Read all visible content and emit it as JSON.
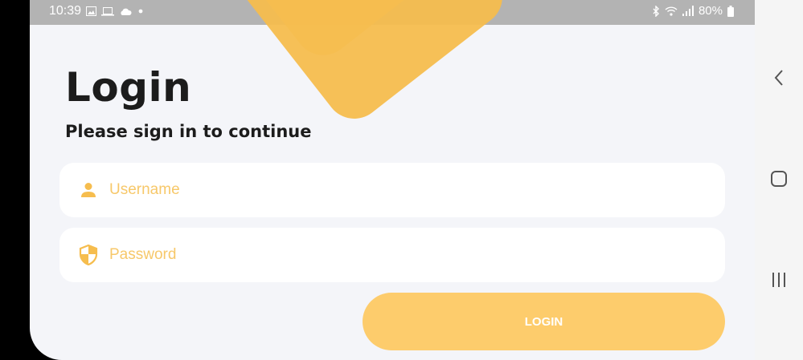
{
  "status_bar": {
    "time": "10:39",
    "battery": "80%",
    "icons": [
      "image-icon",
      "laptop-icon",
      "cloud-icon",
      "dot-icon",
      "bluetooth-icon",
      "wifi-icon",
      "signal-icon",
      "battery-icon"
    ]
  },
  "login": {
    "title": "Login",
    "subtitle": "Please sign in to continue",
    "username_placeholder": "Username",
    "password_placeholder": "Password",
    "button_label": "LOGIN"
  },
  "navigation": {
    "buttons": [
      "back-icon",
      "home-icon",
      "recents-icon"
    ]
  },
  "colors": {
    "accent": "#fdcc6c",
    "icon": "#f6bd4e",
    "background": "#f4f5f9",
    "status_bar": "#b3b3b3"
  }
}
